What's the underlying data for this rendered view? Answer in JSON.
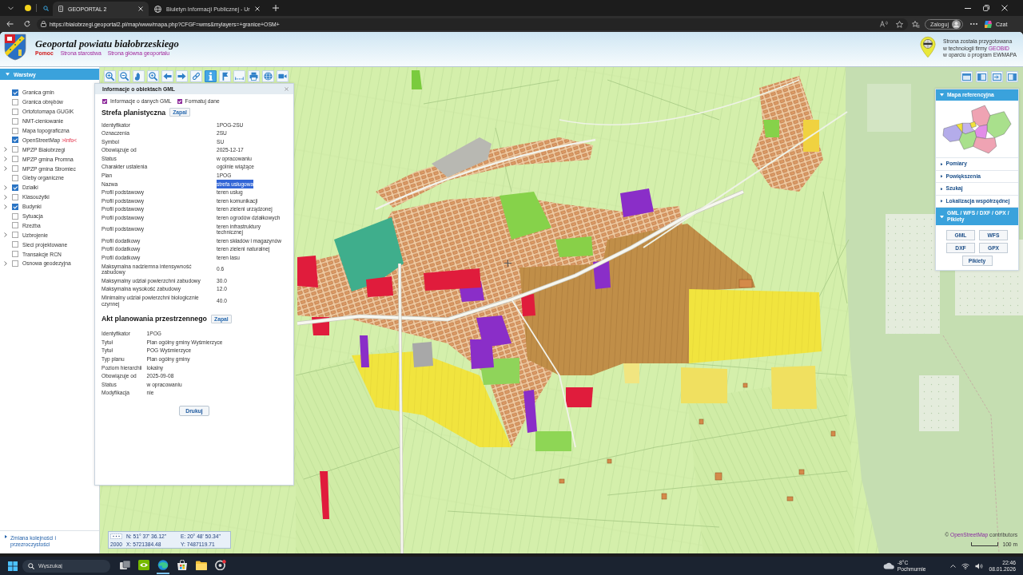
{
  "browser": {
    "tabs": [
      {
        "title": "GEOPORTAL 2",
        "selected": true
      },
      {
        "title": "Biuletyn Informacji Publicznej - Ur",
        "selected": false
      }
    ],
    "url": "https://bialobrzegi.geoportal2.pl/map/www/mapa.php?CFGF=wms&mylayers=+granice+OSM+",
    "profile_button": "Zaloguj",
    "chat_button": "Czat"
  },
  "header": {
    "title": "Geoportal powiatu białobrzeskiego",
    "links": [
      {
        "label": "Pomoc",
        "kind": "help"
      },
      {
        "label": "Strona starostwa",
        "kind": "link"
      },
      {
        "label": "Strona główna geoportalu",
        "kind": "link"
      }
    ],
    "credit": [
      {
        "text": "Strona została przygotowana"
      },
      {
        "text": "w technologii firmy",
        "link": "GEOBID"
      },
      {
        "text": "w oparciu o program EWMAPA"
      }
    ]
  },
  "layers_panel": {
    "title": "Warstwy",
    "expanded": true,
    "layers": [
      {
        "label": "Granica gmin",
        "checked": true,
        "expandable": false
      },
      {
        "label": "Granica obrębów",
        "checked": false,
        "expandable": false
      },
      {
        "label": "Ortofotomapa GUGIK",
        "checked": false,
        "expandable": false
      },
      {
        "label": "NMT-cieniowanie",
        "checked": false,
        "expandable": false
      },
      {
        "label": "Mapa topograficzna",
        "checked": false,
        "expandable": false
      },
      {
        "label": "OpenStreetMap",
        "checked": true,
        "expandable": false,
        "info_link": ">Info<"
      },
      {
        "label": "MPZP Białobrzegi",
        "checked": false,
        "expandable": true
      },
      {
        "label": "MPZP gmina Promna",
        "checked": false,
        "expandable": true
      },
      {
        "label": "MPZP gmina Stromiec",
        "checked": false,
        "expandable": true
      },
      {
        "label": "Gleby organiczne",
        "checked": false,
        "expandable": false
      },
      {
        "label": "Działki",
        "checked": true,
        "expandable": true
      },
      {
        "label": "Klasoużytki",
        "checked": false,
        "expandable": true
      },
      {
        "label": "Budynki",
        "checked": true,
        "expandable": true
      },
      {
        "label": "Sytuacja",
        "checked": false,
        "expandable": false
      },
      {
        "label": "Rzeźba",
        "checked": false,
        "expandable": false
      },
      {
        "label": "Uzbrojenie",
        "checked": false,
        "expandable": true
      },
      {
        "label": "Sieci projektowane",
        "checked": false,
        "expandable": false
      },
      {
        "label": "Transakcje RCN",
        "checked": false,
        "expandable": false
      },
      {
        "label": "Osnowa geodezyjna",
        "checked": false,
        "expandable": true
      }
    ],
    "footer_link": "Zmiana kolejności i przezroczystości"
  },
  "toolbar": {
    "tools": [
      {
        "kind": "zoom-in",
        "selected": false
      },
      {
        "kind": "zoom-out",
        "selected": false
      },
      {
        "kind": "pan",
        "selected": false
      },
      {
        "kind": "zoom-area",
        "selected": false
      },
      {
        "kind": "back",
        "selected": false
      },
      {
        "kind": "forward",
        "selected": false
      },
      {
        "kind": "link",
        "selected": false
      },
      {
        "kind": "info",
        "selected": true
      },
      {
        "kind": "flag",
        "selected": false
      },
      {
        "kind": "measure",
        "selected": false
      },
      {
        "kind": "print",
        "selected": false
      },
      {
        "kind": "globe",
        "selected": false
      },
      {
        "kind": "camera",
        "selected": false
      }
    ]
  },
  "info_panel": {
    "title": "Informacje o obiektach GML",
    "options": [
      {
        "label": "Informacje o danych GML",
        "checked": true
      },
      {
        "label": "Formatuj dane",
        "checked": true
      }
    ],
    "sections": [
      {
        "title": "Strefa planistyczna",
        "button": "Zapal",
        "rows": [
          {
            "key": "Identyfikator",
            "value": "1POG-2SU",
            "selected": false
          },
          {
            "key": "Oznaczenia",
            "value": "2SU",
            "selected": false
          },
          {
            "key": "Symbol",
            "value": "SU",
            "selected": false
          },
          {
            "key": "Obowiązuje od",
            "value": "2025-12-17",
            "selected": false
          },
          {
            "key": "Status",
            "value": "w opracowaniu",
            "selected": false
          },
          {
            "key": "Charakter ustalenia",
            "value": "ogólnie wiążące",
            "selected": false
          },
          {
            "key": "Plan",
            "value": "1POG",
            "selected": false
          },
          {
            "key": "Nazwa",
            "value": "strefa usługowa",
            "selected": true
          },
          {
            "key": "Profil podstawowy",
            "value": "teren usług",
            "selected": false
          },
          {
            "key": "Profil podstawowy",
            "value": "teren komunikacji",
            "selected": false
          },
          {
            "key": "Profil podstawowy",
            "value": "teren zieleni urządzonej",
            "selected": false
          },
          {
            "key": "Profil podstawowy",
            "value": "teren ogrodów działkowych",
            "selected": false
          },
          {
            "key": "Profil podstawowy",
            "value": "teren infrastruktury technicznej",
            "selected": false
          },
          {
            "key": "Profil dodatkowy",
            "value": "teren składów i magazynów",
            "selected": false
          },
          {
            "key": "Profil dodatkowy",
            "value": "teren zieleni naturalnej",
            "selected": false
          },
          {
            "key": "Profil dodatkowy",
            "value": "teren lasu",
            "selected": false
          },
          {
            "key": "Maksymalna nadziemna intensywność zabudowy",
            "value": "0.6",
            "selected": false
          },
          {
            "key": "Maksymalny udział powierzchni zabudowy",
            "value": "30.0",
            "selected": false
          },
          {
            "key": "Maksymalna wysokość zabudowy",
            "value": "12.0",
            "selected": false
          },
          {
            "key": "Minimalny udział powierzchni biologicznie czynnej",
            "value": "40.0",
            "selected": false
          }
        ]
      },
      {
        "title": "Akt planowania przestrzennego",
        "button": "Zapal",
        "rows": [
          {
            "key": "Identyfikator",
            "value": "1POG",
            "selected": false
          },
          {
            "key": "Tytuł",
            "value": "Plan ogólny gminy Wyśmierzyce",
            "selected": false
          },
          {
            "key": "Tytuł",
            "value": "POG Wyśmierzyce",
            "selected": false
          },
          {
            "key": "Typ planu",
            "value": "Plan ogólny gminy",
            "selected": false
          },
          {
            "key": "Poziom hierarchii",
            "value": "lokalny",
            "selected": false
          },
          {
            "key": "Obowiązuje od",
            "value": "2025-09-08",
            "selected": false
          },
          {
            "key": "Status",
            "value": "w opracowaniu",
            "selected": false
          },
          {
            "key": "Modyfikacja",
            "value": "nie",
            "selected": false
          }
        ]
      }
    ],
    "print_button": "Drukuj"
  },
  "side_panel": {
    "sections": [
      {
        "title": "Mapa referencyjna",
        "expanded": true,
        "kind": "reference-map"
      },
      {
        "title": "Pomiary",
        "expanded": false
      },
      {
        "title": "Powiększenia",
        "expanded": false
      },
      {
        "title": "Szukaj",
        "expanded": false
      },
      {
        "title": "Lokalizacja współrzędnej",
        "expanded": false
      },
      {
        "title": "GML / WFS / DXF / GPX / Pikiety",
        "expanded": true,
        "kind": "downloads",
        "buttons": [
          "GML",
          "WFS",
          "DXF",
          "GPX",
          "Pikiety"
        ]
      }
    ]
  },
  "coordinates": {
    "scale": "2000",
    "lat": "N: 51° 37' 36.12\"",
    "lon": "E: 20° 48' 50.34\"",
    "x": "X: 5721384.48",
    "y": "Y: 7487119.71"
  },
  "attribution": {
    "prefix": "©",
    "link": "OpenStreetMap",
    "suffix": "contributors"
  },
  "scale_bar": {
    "label": "100 m"
  },
  "taskbar": {
    "search_placeholder": "Wyszukaj",
    "apps": [
      {
        "kind": "task-view",
        "selected": false
      },
      {
        "kind": "eye",
        "selected": false
      },
      {
        "kind": "browser",
        "selected": true
      },
      {
        "kind": "store",
        "selected": false
      },
      {
        "kind": "folder",
        "selected": false
      },
      {
        "kind": "ring",
        "selected": false
      }
    ],
    "weather": {
      "temperature": "-8°C",
      "condition": "Pochmurnie"
    },
    "time": "22:46",
    "date": "08.01.2026"
  }
}
